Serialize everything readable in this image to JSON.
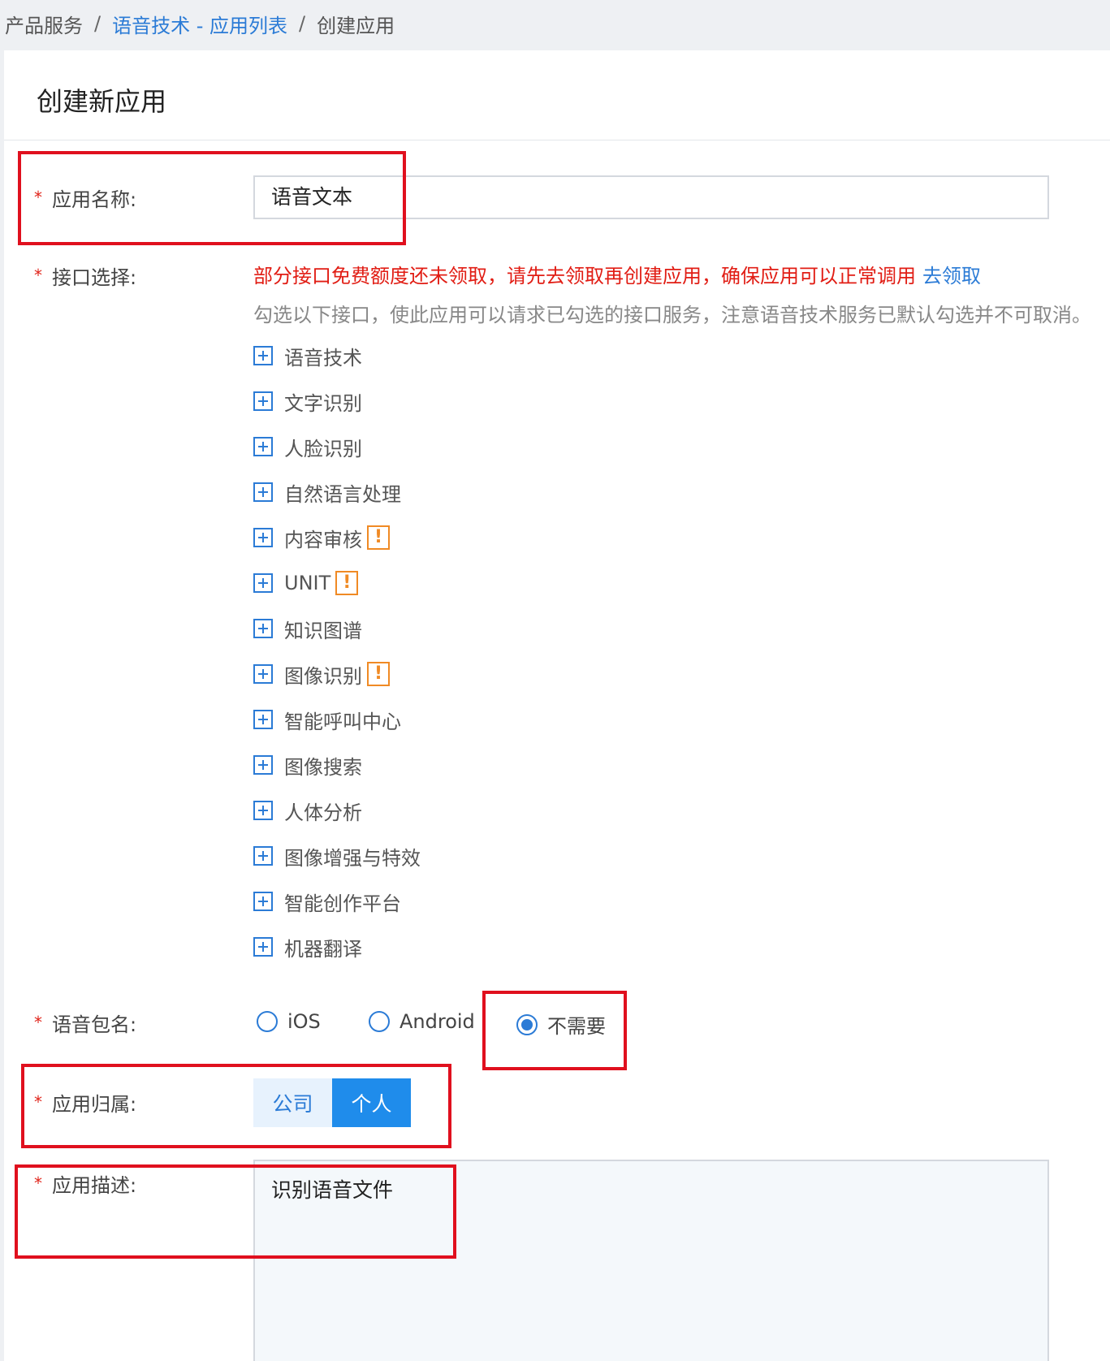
{
  "breadcrumb": {
    "root": "产品服务",
    "separator": "/",
    "parent": "语音技术 - 应用列表",
    "current": "创建应用"
  },
  "page_title": "创建新应用",
  "form": {
    "app_name": {
      "label": "应用名称:",
      "value": "语音文本"
    },
    "api_select": {
      "label": "接口选择:",
      "warning": "部分接口免费额度还未领取，请先去领取再创建应用，确保应用可以正常调用",
      "warning_link": "去领取",
      "hint": "勾选以下接口，使此应用可以请求已勾选的接口服务，注意语音技术服务已默认勾选并不可取消。",
      "items": [
        {
          "label": "语音技术",
          "badge": ""
        },
        {
          "label": "文字识别",
          "badge": ""
        },
        {
          "label": "人脸识别",
          "badge": ""
        },
        {
          "label": "自然语言处理",
          "badge": ""
        },
        {
          "label": "内容审核",
          "badge": "!"
        },
        {
          "label": "UNIT",
          "badge": "!"
        },
        {
          "label": "知识图谱",
          "badge": ""
        },
        {
          "label": "图像识别",
          "badge": "!"
        },
        {
          "label": "智能呼叫中心",
          "badge": ""
        },
        {
          "label": "图像搜索",
          "badge": ""
        },
        {
          "label": "人体分析",
          "badge": ""
        },
        {
          "label": "图像增强与特效",
          "badge": ""
        },
        {
          "label": "智能创作平台",
          "badge": ""
        },
        {
          "label": "机器翻译",
          "badge": ""
        }
      ]
    },
    "voice_package": {
      "label": "语音包名:",
      "options": [
        "iOS",
        "Android",
        "不需要"
      ],
      "selected": "不需要"
    },
    "ownership": {
      "label": "应用归属:",
      "options": [
        "公司",
        "个人"
      ],
      "selected": "个人"
    },
    "description": {
      "label": "应用描述:",
      "value": "识别语音文件"
    }
  },
  "colors": {
    "accent": "#2b7bd6",
    "required_star": "#e0241a",
    "warning_text": "#e11d14",
    "badge": "#f08a24",
    "annotation_box": "#e0101e"
  }
}
